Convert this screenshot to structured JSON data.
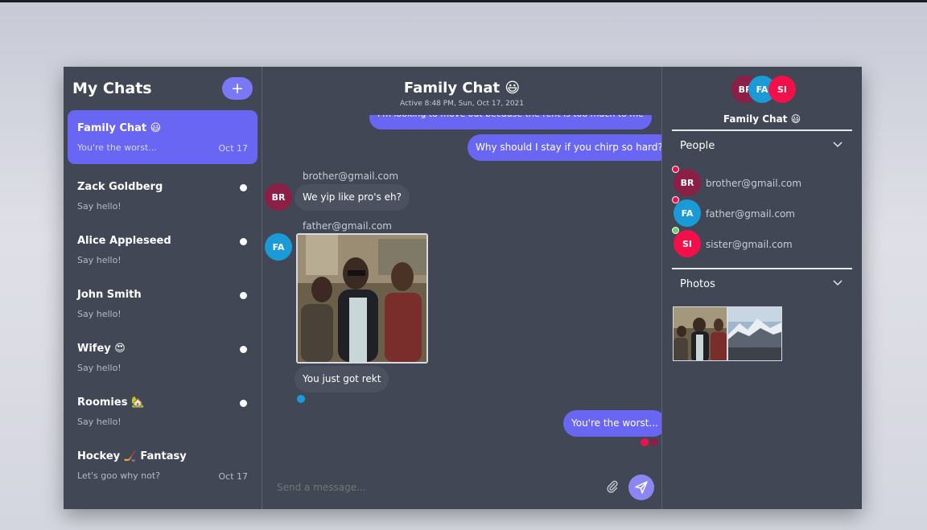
{
  "sidebar": {
    "title": "My Chats",
    "new_chat_icon": "plus",
    "chats": [
      {
        "name": "Family Chat 😃",
        "preview": "You're the worst...",
        "date": "Oct 17",
        "active": true,
        "unread": false
      },
      {
        "name": "Zack Goldberg",
        "preview": "Say hello!",
        "date": "",
        "active": false,
        "unread": true
      },
      {
        "name": "Alice Appleseed",
        "preview": "Say hello!",
        "date": "",
        "active": false,
        "unread": true
      },
      {
        "name": "John Smith",
        "preview": "Say hello!",
        "date": "",
        "active": false,
        "unread": true
      },
      {
        "name": "Wifey 😍",
        "preview": "Say hello!",
        "date": "",
        "active": false,
        "unread": true
      },
      {
        "name": "Roomies 🏡",
        "preview": "Say hello!",
        "date": "",
        "active": false,
        "unread": true
      },
      {
        "name": "Hockey 🏒 Fantasy",
        "preview": "Let's goo why not?",
        "date": "Oct 17",
        "active": false,
        "unread": false
      }
    ]
  },
  "chat": {
    "title": "Family Chat 😃",
    "subtitle": "Active 8:48 PM, Sun, Oct 17, 2021",
    "messages": {
      "cutoff": "I'm looking to move out because the rent is too much to me",
      "mine_1": "Why should I stay if you chirp so hard?",
      "sender_br": "brother@gmail.com",
      "avatar_br": "BR",
      "theirs_1": "We yip like pro's eh?",
      "sender_fa": "father@gmail.com",
      "avatar_fa": "FA",
      "theirs_2": "You just got rekt",
      "mine_2": "You're the worst..."
    },
    "composer_placeholder": "Send a message...",
    "attach_icon": "paperclip",
    "send_icon": "paper-plane"
  },
  "details": {
    "avatars": [
      "BR",
      "FA",
      "SI"
    ],
    "title": "Family Chat 😃",
    "people_label": "People",
    "people": [
      {
        "initials": "BR",
        "email": "brother@gmail.com",
        "online": false
      },
      {
        "initials": "FA",
        "email": "father@gmail.com",
        "online": false
      },
      {
        "initials": "SI",
        "email": "sister@gmail.com",
        "online": true
      }
    ],
    "photos_label": "Photos"
  },
  "colors": {
    "accent": "#6a66f4",
    "panel": "#414754",
    "brother": "#8b1f45",
    "father": "#1b9ad8",
    "sister": "#f2104a",
    "offline": "#f2104a",
    "online": "#6fd36a"
  }
}
